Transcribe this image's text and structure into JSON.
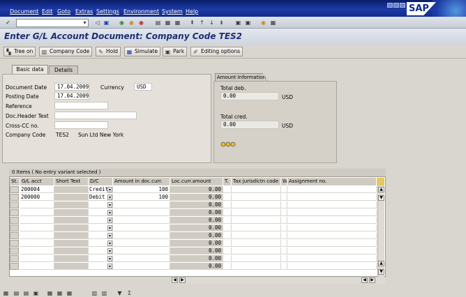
{
  "menu": [
    "Document",
    "Edit",
    "Goto",
    "Extras",
    "Settings",
    "Environment",
    "System",
    "Help"
  ],
  "logo": "SAP",
  "title": "Enter G/L Account Document: Company Code TES2",
  "toolbar": {
    "tree_on": "Tree on",
    "company_code": "Company Code",
    "hold": "Hold",
    "simulate": "Simulate",
    "park": "Park",
    "editing_options": "Editing options"
  },
  "tabs": {
    "basic": "Basic data",
    "details": "Details"
  },
  "form": {
    "document_date_label": "Document Date",
    "document_date": "17.04.2009",
    "currency_label": "Currency",
    "currency": "USD",
    "posting_date_label": "Posting Date",
    "posting_date": "17.04.2009",
    "reference_label": "Reference",
    "doc_header_label": "Doc.Header Text",
    "cross_cc_label": "Cross-CC no.",
    "company_code_label": "Company Code",
    "company_code": "TES2",
    "company_name": "Sun Ltd New York"
  },
  "amount": {
    "tab": "Amount Information",
    "total_deb_label": "Total deb.",
    "total_deb": "0.00",
    "total_deb_cur": "USD",
    "total_cred_label": "Total cred.",
    "total_cred": "0.00",
    "total_cred_cur": "USD"
  },
  "grid": {
    "caption": "0 Items ( No entry variant selected )",
    "headers": [
      "St.",
      "G/L acct",
      "Short Text",
      "D/C",
      "Amount in doc.curr.",
      "Loc.curr.amount",
      "T.",
      "Tax jurisdictn code",
      "W",
      "Assignment no."
    ],
    "rows": [
      {
        "gl": "200004",
        "dc": "Credit",
        "amt": "100",
        "loc": "0.00"
      },
      {
        "gl": "200000",
        "dc": "Debit",
        "amt": "100",
        "loc": "0.00"
      },
      {
        "gl": "",
        "dc": "",
        "amt": "",
        "loc": "0.00"
      },
      {
        "gl": "",
        "dc": "",
        "amt": "",
        "loc": "0.00"
      },
      {
        "gl": "",
        "dc": "",
        "amt": "",
        "loc": "0.00"
      },
      {
        "gl": "",
        "dc": "",
        "amt": "",
        "loc": "0.00"
      },
      {
        "gl": "",
        "dc": "",
        "amt": "",
        "loc": "0.00"
      },
      {
        "gl": "",
        "dc": "",
        "amt": "",
        "loc": "0.00"
      },
      {
        "gl": "",
        "dc": "",
        "amt": "",
        "loc": "0.00"
      },
      {
        "gl": "",
        "dc": "",
        "amt": "",
        "loc": "0.00"
      },
      {
        "gl": "",
        "dc": "",
        "amt": "",
        "loc": "0.00"
      }
    ]
  }
}
